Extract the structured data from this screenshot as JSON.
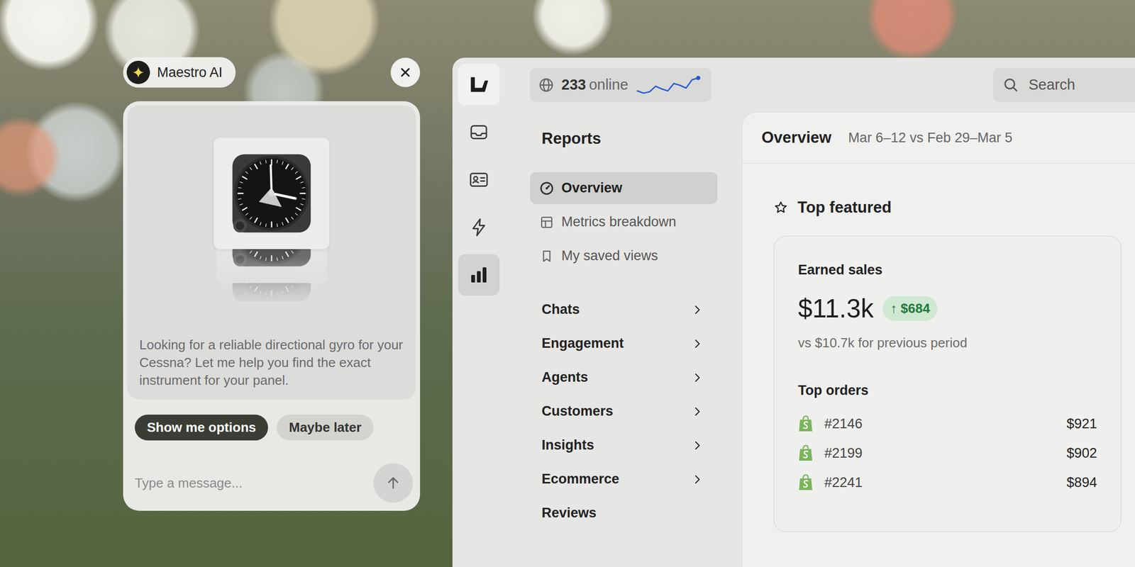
{
  "assistant": {
    "name": "Maestro AI",
    "message": "Looking for a reliable directional gyro for your Cessna? Let me help you find the exact instrument for your panel.",
    "actions": [
      {
        "label": "Show me options",
        "primary": true
      },
      {
        "label": "Maybe later",
        "primary": false
      }
    ],
    "input": {
      "placeholder": "Type a message..."
    }
  },
  "rail": [
    {
      "kind": "logo",
      "selected": false
    },
    {
      "kind": "inbox",
      "selected": false
    },
    {
      "kind": "contacts",
      "selected": false
    },
    {
      "kind": "automations",
      "selected": false
    },
    {
      "kind": "reports",
      "selected": true
    }
  ],
  "online": {
    "count": "233",
    "label": "online",
    "trend": [
      2,
      1.5,
      1.8,
      3,
      2.4,
      2,
      3.6,
      3.2,
      2.6,
      4.4,
      4.8
    ]
  },
  "search": {
    "placeholder": "Search"
  },
  "reports": {
    "title": "Reports",
    "views": [
      {
        "label": "Overview",
        "kind": "overview",
        "selected": true
      },
      {
        "label": "Metrics breakdown",
        "kind": "metrics",
        "selected": false
      },
      {
        "label": "My saved views",
        "kind": "saved",
        "selected": false
      }
    ],
    "sections": [
      {
        "label": "Chats",
        "expandable": true
      },
      {
        "label": "Engagement",
        "expandable": true
      },
      {
        "label": "Agents",
        "expandable": true
      },
      {
        "label": "Customers",
        "expandable": true
      },
      {
        "label": "Insights",
        "expandable": true
      },
      {
        "label": "Ecommerce",
        "expandable": true
      },
      {
        "label": "Reviews",
        "expandable": false
      }
    ]
  },
  "overview": {
    "title": "Overview",
    "period": "Mar 6–12 vs Feb 29–Mar 5",
    "featured": {
      "title": "Top featured",
      "card": {
        "title": "Earned sales",
        "value": "$11.3k",
        "change": "↑ $684",
        "comparison": "vs $10.7k for previous period",
        "orders_title": "Top orders",
        "orders": [
          {
            "id": "#2146",
            "amount": "$921"
          },
          {
            "id": "#2199",
            "amount": "$902"
          },
          {
            "id": "#2241",
            "amount": "$894"
          }
        ]
      }
    }
  }
}
